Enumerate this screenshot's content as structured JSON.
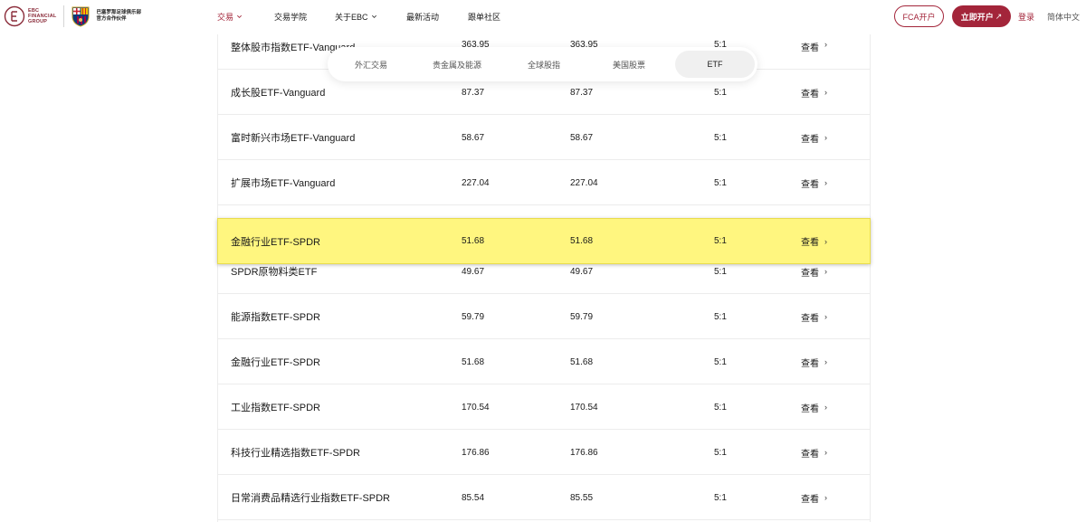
{
  "nav": {
    "logo": {
      "ebc_lines": [
        "EBC",
        "FINANCIAL",
        "GROUP"
      ],
      "partner_lines": [
        "巴塞罗那足球俱乐部",
        "官方合作伙伴"
      ]
    },
    "menu": [
      {
        "label": "交易",
        "has_dropdown": true,
        "active": true
      },
      {
        "label": "交易学院",
        "has_dropdown": false,
        "active": false
      },
      {
        "label": "关于EBC",
        "has_dropdown": true,
        "active": false
      },
      {
        "label": "最新活动",
        "has_dropdown": false,
        "active": false
      },
      {
        "label": "跟单社区",
        "has_dropdown": false,
        "active": false
      }
    ],
    "fca_button": "FCA开户",
    "open_account_button": "立即开户",
    "open_account_arrow": "↗",
    "login": "登录",
    "language": "简体中文"
  },
  "tabs": {
    "items": [
      "外汇交易",
      "贵金属及能源",
      "全球股指",
      "美国股票",
      "ETF"
    ],
    "active": "ETF"
  },
  "table": {
    "view_label": "查看",
    "view_chevron": "›",
    "rows": [
      {
        "name": "整体股市指数ETF-Vanguard",
        "bid": "363.95",
        "ask": "363.95",
        "leverage": "5:1"
      },
      {
        "name": "成长股ETF-Vanguard",
        "bid": "87.37",
        "ask": "87.37",
        "leverage": "5:1"
      },
      {
        "name": "富时新兴市场ETF-Vanguard",
        "bid": "58.67",
        "ask": "58.67",
        "leverage": "5:1"
      },
      {
        "name": "扩展市场ETF-Vanguard",
        "bid": "227.04",
        "ask": "227.04",
        "leverage": "5:1"
      },
      {
        "name": "SPDR原物料类ETF",
        "bid": "49.67",
        "ask": "49.67",
        "leverage": "5:1"
      },
      {
        "name": "能源指数ETF-SPDR",
        "bid": "59.79",
        "ask": "59.79",
        "leverage": "5:1"
      },
      {
        "name": "金融行业ETF-SPDR",
        "bid": "51.68",
        "ask": "51.68",
        "leverage": "5:1"
      },
      {
        "name": "工业指数ETF-SPDR",
        "bid": "170.54",
        "ask": "170.54",
        "leverage": "5:1"
      },
      {
        "name": "科技行业精选指数ETF-SPDR",
        "bid": "176.86",
        "ask": "176.86",
        "leverage": "5:1"
      },
      {
        "name": "日常消费品精选行业指数ETF-SPDR",
        "bid": "85.54",
        "ask": "85.55",
        "leverage": "5:1"
      }
    ],
    "highlighted_row": {
      "name": "金融行业ETF-SPDR",
      "bid": "51.68",
      "ask": "51.68",
      "leverage": "5:1"
    }
  },
  "colors": {
    "brand": "#a3253a",
    "highlight": "#fff67f"
  }
}
